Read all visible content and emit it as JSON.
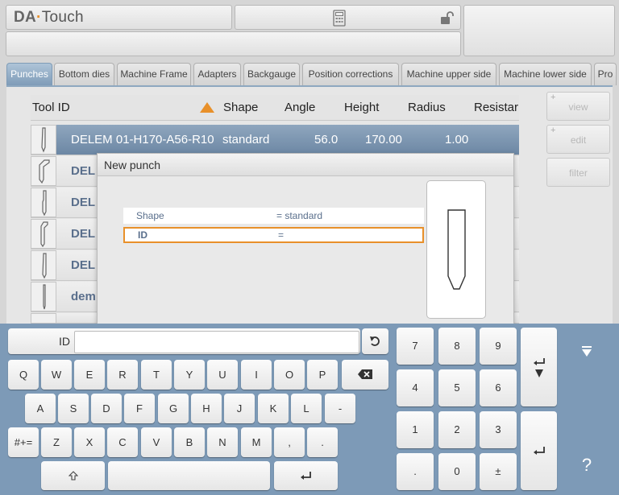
{
  "app": {
    "logo_a": "DA",
    "logo_dot": "·",
    "logo_b": "Touch"
  },
  "tabs": [
    "Punches",
    "Bottom dies",
    "Machine Frame",
    "Adapters",
    "Backgauge",
    "Position corrections",
    "Machine upper side",
    "Machine lower side",
    "Pro"
  ],
  "table": {
    "headers": {
      "tool_id": "Tool ID",
      "shape": "Shape",
      "angle": "Angle",
      "height": "Height",
      "radius": "Radius",
      "resist": "Resistar"
    },
    "selected": {
      "tool_id": "DELEM 01-H170-A56-R10",
      "shape": "standard",
      "angle": "56.0",
      "height": "170.00",
      "radius": "1.00"
    },
    "rows": [
      "DEL",
      "DEL",
      "DEL",
      "DEL",
      "dem"
    ]
  },
  "side_buttons": {
    "view": "view",
    "edit": "edit",
    "filter": "filter",
    "plus": "+"
  },
  "dialog": {
    "title": "New punch",
    "fields": [
      {
        "label": "Shape",
        "value": "=  standard"
      },
      {
        "label": "ID",
        "value": "="
      }
    ]
  },
  "keyboard": {
    "id_label": "ID",
    "id_value": "",
    "row1": [
      "Q",
      "W",
      "E",
      "R",
      "T",
      "Y",
      "U",
      "I",
      "O",
      "P"
    ],
    "row2": [
      "A",
      "S",
      "D",
      "F",
      "G",
      "H",
      "J",
      "K",
      "L",
      "-"
    ],
    "row3": [
      "Z",
      "X",
      "C",
      "V",
      "B",
      "N",
      "M",
      ",",
      "."
    ],
    "symbols": "#+=",
    "numpad": [
      "7",
      "8",
      "9",
      "4",
      "5",
      "6",
      "1",
      "2",
      "3",
      ".",
      "0",
      "±"
    ],
    "help": "?"
  },
  "colors": {
    "accent": "#e8902a",
    "keyboard_bg": "#7d9ab7",
    "selected_row": "#7a93ae"
  }
}
